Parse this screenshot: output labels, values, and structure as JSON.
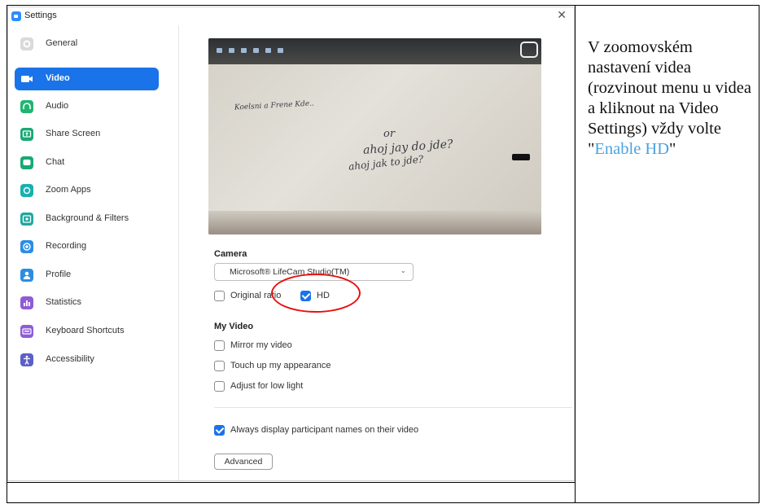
{
  "window": {
    "title": "Settings",
    "close_glyph": "✕"
  },
  "sidebar": {
    "items": [
      {
        "label": "General",
        "icon": "gear-icon",
        "color": "#c8c8c8",
        "active": false
      },
      {
        "label": "Video",
        "icon": "video-camera-icon",
        "color": "#ffffff",
        "active": true
      },
      {
        "label": "Audio",
        "icon": "headphones-icon",
        "color": "#21b573",
        "active": false
      },
      {
        "label": "Share Screen",
        "icon": "share-screen-icon",
        "color": "#19a974",
        "active": false
      },
      {
        "label": "Chat",
        "icon": "chat-bubble-icon",
        "color": "#19a974",
        "active": false
      },
      {
        "label": "Zoom Apps",
        "icon": "zoom-apps-icon",
        "color": "#19b0b0",
        "active": false
      },
      {
        "label": "Background & Filters",
        "icon": "background-icon",
        "color": "#1ea8a0",
        "active": false
      },
      {
        "label": "Recording",
        "icon": "recording-icon",
        "color": "#2b8de3",
        "active": false
      },
      {
        "label": "Profile",
        "icon": "profile-icon",
        "color": "#2b8de3",
        "active": false
      },
      {
        "label": "Statistics",
        "icon": "statistics-icon",
        "color": "#8f5bd6",
        "active": false
      },
      {
        "label": "Keyboard Shortcuts",
        "icon": "keyboard-icon",
        "color": "#8f5bd6",
        "active": false
      },
      {
        "label": "Accessibility",
        "icon": "accessibility-icon",
        "color": "#5b5fc7",
        "active": false
      }
    ]
  },
  "camera": {
    "section_label": "Camera",
    "selected_device": "Microsoft® LifeCam Studio(TM)",
    "original_ratio_label": "Original ratio",
    "original_ratio_checked": false,
    "hd_label": "HD",
    "hd_checked": true
  },
  "my_video": {
    "section_label": "My Video",
    "options": [
      {
        "label": "Mirror my video",
        "checked": false
      },
      {
        "label": "Touch up my appearance",
        "checked": false
      },
      {
        "label": "Adjust for low light",
        "checked": false
      }
    ]
  },
  "names_option": {
    "label": "Always display participant names on their video",
    "checked": true
  },
  "advanced_button": "Advanced",
  "annotation_text": {
    "before": "V zoomovském nastavení videa (rozvinout menu u videa a kliknout na Video Settings) vždy volte \"",
    "link": "Enable HD",
    "after": "\""
  },
  "colors": {
    "accent": "#1a73e8",
    "highlight_circle": "#e81010",
    "link": "#4aa3df"
  }
}
